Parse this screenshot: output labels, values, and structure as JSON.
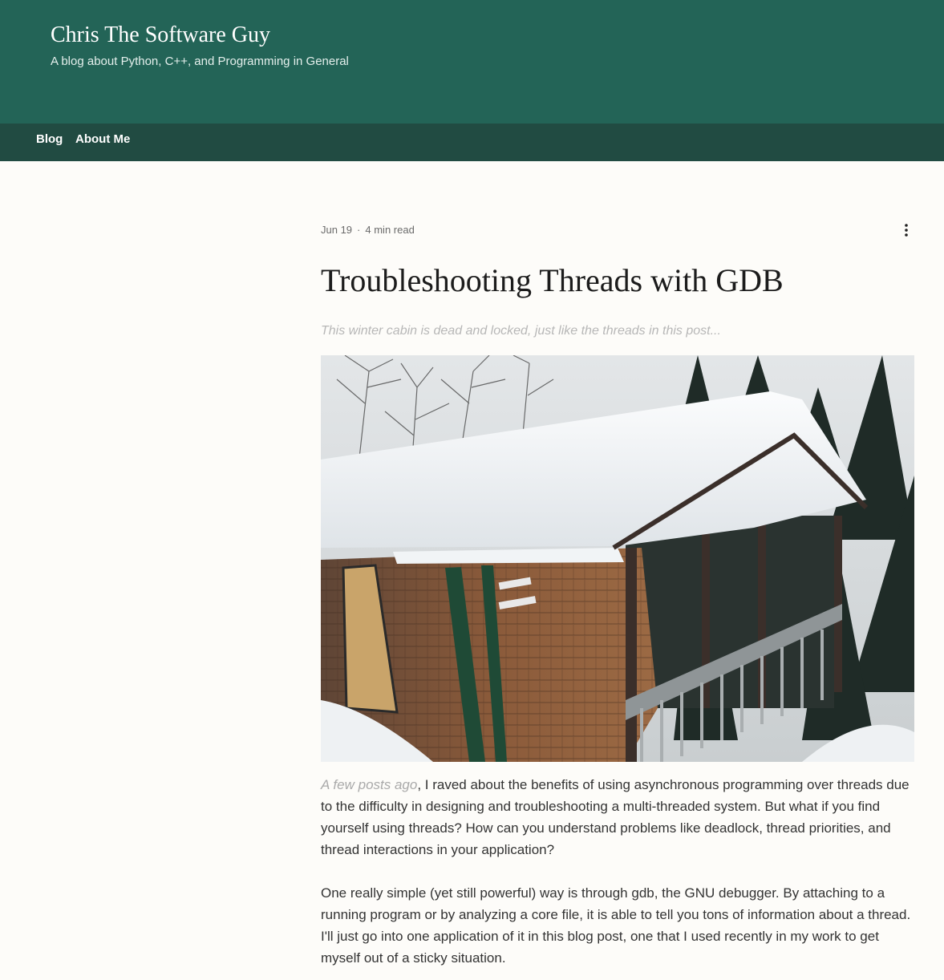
{
  "site": {
    "title": "Chris The Software Guy",
    "tagline": "A blog about Python, C++, and Programming in General"
  },
  "nav": {
    "items": [
      {
        "label": "Blog"
      },
      {
        "label": "About Me"
      }
    ]
  },
  "post": {
    "date": "Jun 19",
    "separator": "·",
    "read_time": "4 min read",
    "title": "Troubleshooting Threads with GDB",
    "caption": "This winter cabin is dead and locked, just like the threads in this post...",
    "paragraph1_link": "A few posts ago",
    "paragraph1_rest": ", I raved about the benefits of using asynchronous programming over threads due to the difficulty in designing and troubleshooting a multi-threaded system. But what if you find yourself using threads? How can you understand problems like deadlock, thread priorities, and thread interactions in your application?",
    "paragraph2": "One really simple (yet still powerful) way is through gdb, the GNU debugger. By attaching to a running program or by analyzing a core file, it is able to tell you tons of information about a thread. I'll just go into one application of it in this blog post, one that I used recently in my work to get myself out of a sticky situation."
  },
  "icons": {
    "more": "more-vertical-icon"
  },
  "colors": {
    "header": "#236457",
    "nav": "#214b42",
    "background": "#fdfcf9"
  }
}
